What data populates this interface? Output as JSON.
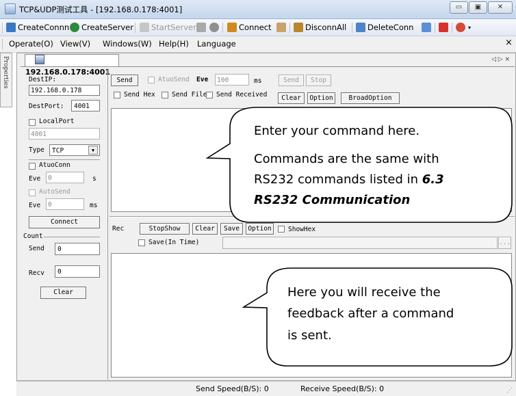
{
  "window": {
    "title": "TCP&UDP测试工具 - [192.168.0.178:4001]",
    "controls": [
      "minimize-icon",
      "maximize-icon",
      "close-icon"
    ]
  },
  "toolbar": {
    "create_conn": "CreateConnn",
    "create_server": "CreateServer",
    "start_server": "StartServer",
    "connect": "Connect",
    "disconn_all": "DisconnAll",
    "delete_conn": "DeleteConn"
  },
  "menu": {
    "operate": "Operate(O)",
    "view": "View(V)",
    "windows": "Windows(W)",
    "help": "Help(H)",
    "language": "Language",
    "close": "×"
  },
  "side_tab": "Properties",
  "doc_tab": {
    "label": "192.168.0.178:4001",
    "controls": "◁ ▷ ×"
  },
  "left_panel": {
    "dest_ip_label": "DestIP:",
    "dest_ip": "192.168.0.178",
    "dest_port_label": "DestPort:",
    "dest_port": "4001",
    "local_port_label": "LocalPort",
    "local_port": "4001",
    "type_label": "Type",
    "type_value": "TCP",
    "auto_conn_label": "AtuoConn",
    "eve_label": "Eve",
    "auto_conn_eve": "0",
    "s_unit": "s",
    "auto_send_label": "AutoSend",
    "auto_send_eve": "0",
    "ms_unit": "ms",
    "connect_button": "Connect",
    "count_label": "Count",
    "send_label": "Send",
    "send_count": "0",
    "recv_label": "Recv",
    "recv_count": "0",
    "clear_button": "Clear"
  },
  "send_panel": {
    "send_button": "Send",
    "auto_send_label": "AtuoSend",
    "eve_label": "Eve",
    "eve_value": "100",
    "ms_unit": "ms",
    "send_button2": "Send",
    "stop_button": "Stop",
    "send_hex_label": "Send Hex",
    "send_file_label": "Send File",
    "send_received_label": "Send Received",
    "clear_button": "Clear",
    "option_button": "Option",
    "broad_option_button": "BroadOption"
  },
  "recv_panel": {
    "rec_label": "Rec",
    "stop_show_button": "StopShow",
    "clear_button": "Clear",
    "save_button": "Save",
    "option_button": "Option",
    "show_hex_label": "ShowHex",
    "save_in_time_label": "Save(In Time)",
    "browse_button": "..."
  },
  "callouts": {
    "send_line1": "Enter your command here.",
    "send_line2": "Commands are the same with",
    "send_line3": "RS232 commands listed in ",
    "send_line3_bold": "6.3",
    "send_line4_bold": "RS232 Communication",
    "recv_line1": "Here you will receive the",
    "recv_line2": "feedback after a command",
    "recv_line3": "is sent."
  },
  "status": {
    "send_speed": "Send Speed(B/S): 0",
    "receive_speed": "Receive Speed(B/S): 0"
  }
}
